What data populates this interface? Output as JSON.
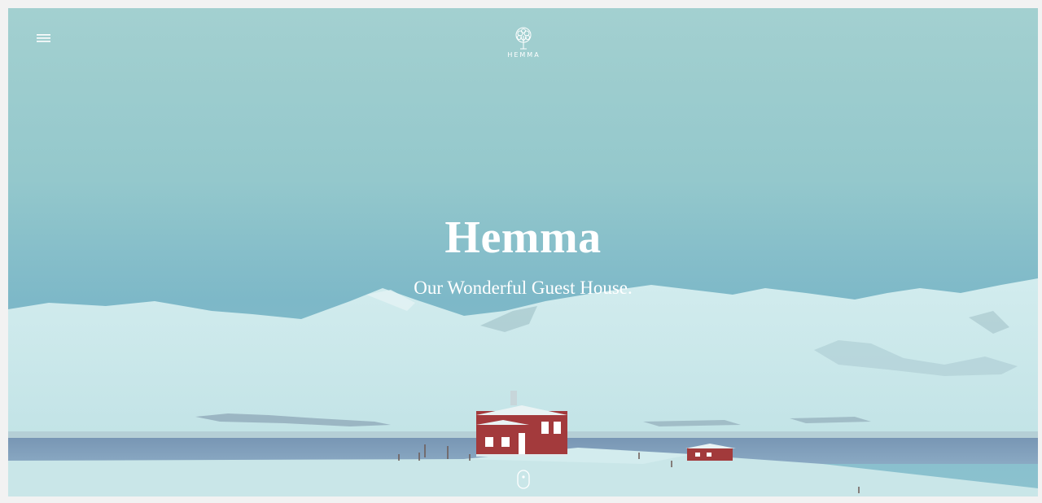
{
  "header": {
    "logo_text": "HEMMA"
  },
  "hero": {
    "title": "Hemma",
    "subtitle": "Our Wonderful Guest House."
  },
  "icons": {
    "menu": "hamburger-menu-icon",
    "logo": "tree-icon",
    "scroll": "mouse-scroll-icon"
  },
  "colors": {
    "sky_top": "#9fcfd1",
    "sky_mid": "#7cb9c9",
    "snow": "#d9eef0",
    "water": "#7f9fbf",
    "house_red": "#a8363a",
    "text": "#ffffff"
  }
}
